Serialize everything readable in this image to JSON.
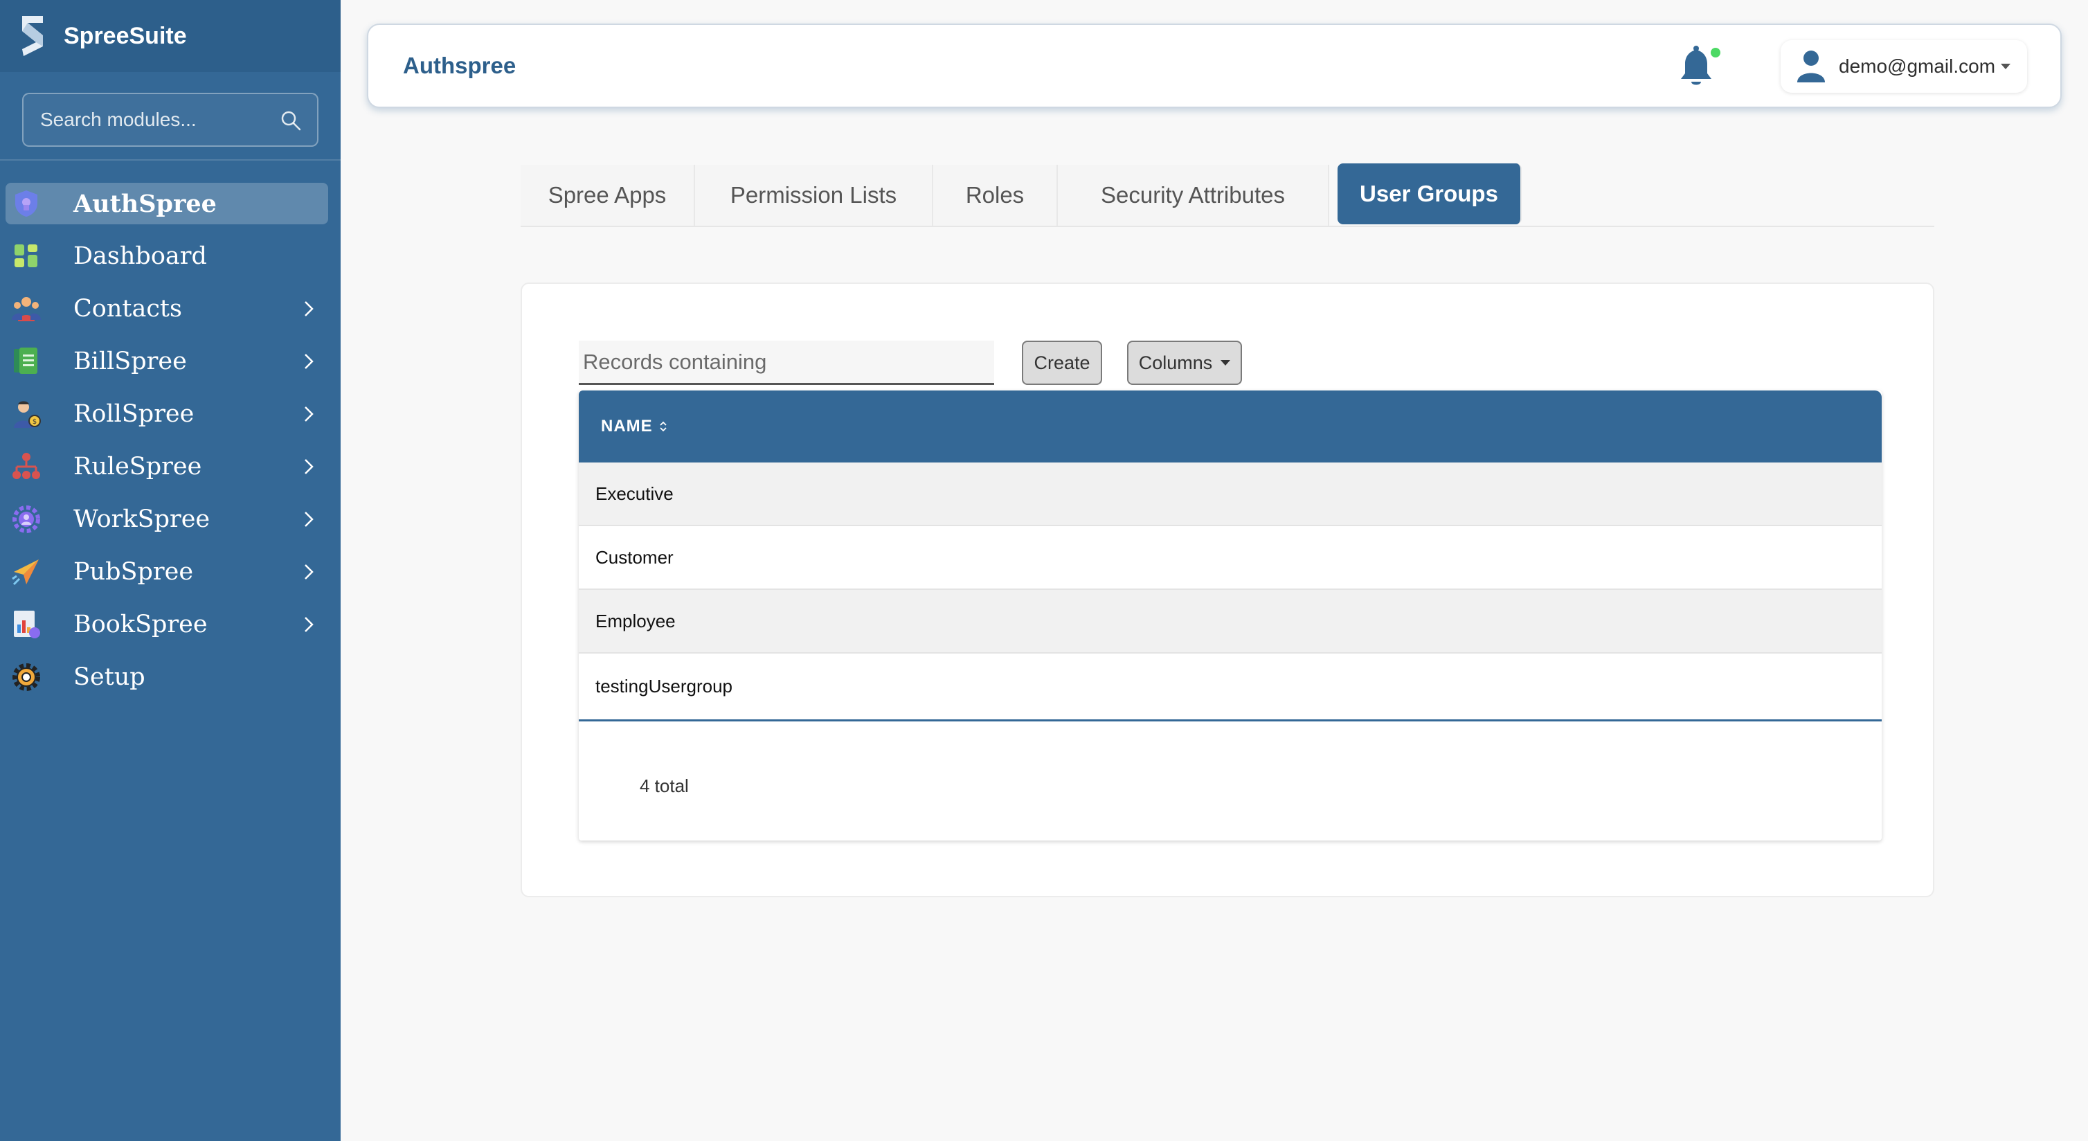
{
  "brand": {
    "name": "SpreeSuite"
  },
  "sidebar": {
    "search_placeholder": "Search modules...",
    "items": [
      {
        "label": "AuthSpree",
        "icon": "shield-lock-icon",
        "active": true,
        "has_children": false
      },
      {
        "label": "Dashboard",
        "icon": "dashboard-grid-icon",
        "has_children": false
      },
      {
        "label": "Contacts",
        "icon": "people-icon",
        "has_children": true
      },
      {
        "label": "BillSpree",
        "icon": "bill-document-icon",
        "has_children": true
      },
      {
        "label": "RollSpree",
        "icon": "worker-icon",
        "has_children": true
      },
      {
        "label": "RuleSpree",
        "icon": "hierarchy-icon",
        "has_children": true
      },
      {
        "label": "WorkSpree",
        "icon": "workflow-gear-icon",
        "has_children": true
      },
      {
        "label": "PubSpree",
        "icon": "paper-plane-icon",
        "has_children": true
      },
      {
        "label": "BookSpree",
        "icon": "ledger-chart-icon",
        "has_children": true
      },
      {
        "label": "Setup",
        "icon": "gear-icon",
        "has_children": false
      }
    ]
  },
  "header": {
    "title": "Authspree",
    "user_email": "demo@gmail.com",
    "notification_status_color": "#4cd964"
  },
  "tabs": [
    {
      "label": "Spree Apps",
      "active": false
    },
    {
      "label": "Permission Lists",
      "active": false
    },
    {
      "label": "Roles",
      "active": false
    },
    {
      "label": "Security Attributes",
      "active": false
    },
    {
      "label": "User Groups",
      "active": true
    }
  ],
  "toolbar": {
    "filter_placeholder": "Records containing",
    "create_label": "Create",
    "columns_label": "Columns"
  },
  "table": {
    "columns": [
      "NAME"
    ],
    "rows": [
      {
        "name": "Executive"
      },
      {
        "name": "Customer"
      },
      {
        "name": "Employee"
      },
      {
        "name": "testingUsergroup"
      }
    ],
    "total_text": "4 total"
  },
  "colors": {
    "primary": "#346896",
    "brand_dark": "#2d5f8b"
  }
}
